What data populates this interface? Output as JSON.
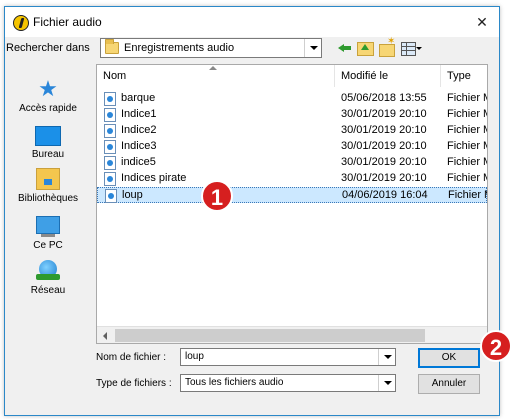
{
  "window": {
    "title": "Fichier audio",
    "close": "✕"
  },
  "lookin": {
    "label": "Rechercher dans",
    "value": "Enregistrements audio"
  },
  "places": [
    {
      "label": "Accès rapide",
      "icon": "star-icon"
    },
    {
      "label": "Bureau",
      "icon": "desktop-icon"
    },
    {
      "label": "Bibliothèques",
      "icon": "libraries-icon"
    },
    {
      "label": "Ce PC",
      "icon": "pc-icon"
    },
    {
      "label": "Réseau",
      "icon": "network-icon"
    }
  ],
  "columns": {
    "name": "Nom",
    "date": "Modifié le",
    "type": "Type"
  },
  "files": [
    {
      "name": "barque",
      "date": "05/06/2018 13:55",
      "type": "Fichier MP"
    },
    {
      "name": "Indice1",
      "date": "30/01/2019 20:10",
      "type": "Fichier MP"
    },
    {
      "name": "Indice2",
      "date": "30/01/2019 20:10",
      "type": "Fichier MP"
    },
    {
      "name": "Indice3",
      "date": "30/01/2019 20:10",
      "type": "Fichier MP"
    },
    {
      "name": "indice5",
      "date": "30/01/2019 20:10",
      "type": "Fichier MP"
    },
    {
      "name": "Indices pirate",
      "date": "30/01/2019 20:10",
      "type": "Fichier MP"
    },
    {
      "name": "loup",
      "date": "04/06/2019 16:04",
      "type": "Fichier MP",
      "selected": true
    }
  ],
  "form": {
    "filename_label": "Nom de fichier :",
    "filename_value": "loup",
    "filetype_label": "Type de fichiers :",
    "filetype_value": "Tous les fichiers audio"
  },
  "buttons": {
    "ok": "OK",
    "cancel": "Annuler"
  },
  "annotations": {
    "step1": "1",
    "step2": "2"
  },
  "colors": {
    "badge": "#d61f1f",
    "selection": "#cce8ff",
    "accent": "#0078d7"
  }
}
